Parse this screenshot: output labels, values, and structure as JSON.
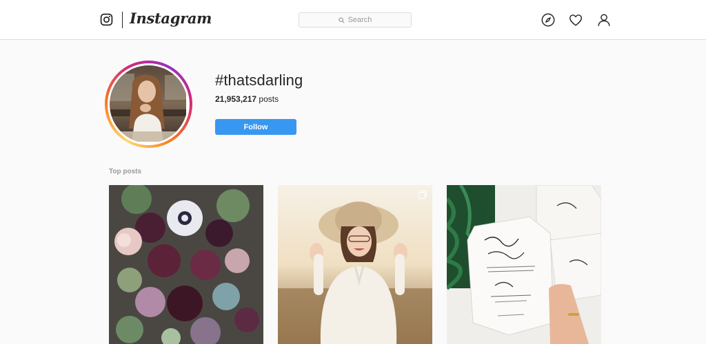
{
  "header": {
    "brand": "Instagram",
    "search_placeholder": "Search",
    "icons": [
      "instagram-logo-icon",
      "compass-icon",
      "heart-icon",
      "user-icon",
      "search-icon"
    ]
  },
  "hashtag": {
    "name": "#thatsdarling",
    "posts_count": "21,953,217",
    "posts_label": "posts",
    "follow_label": "Follow"
  },
  "top_posts": {
    "title": "Top posts"
  },
  "colors": {
    "follow_blue": "#3897f0",
    "border": "#dbdbdb",
    "background": "#fafafa",
    "text": "#262626",
    "muted": "#999999"
  }
}
